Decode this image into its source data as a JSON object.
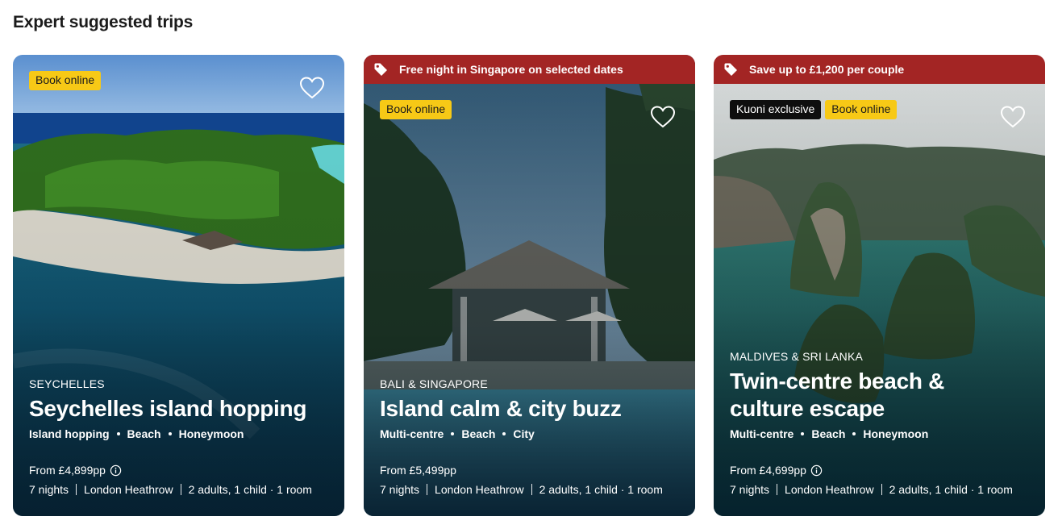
{
  "section": {
    "title": "Expert suggested trips"
  },
  "cards": [
    {
      "promo": "",
      "badges": {
        "primary": "Book online"
      },
      "region": "SEYCHELLES",
      "title_line1": "Seychelles island hopping",
      "title_line2": "",
      "tags": [
        "Island hopping",
        "Beach",
        "Honeymoon"
      ],
      "price": "From £4,899pp",
      "nights": "7 nights",
      "airport": "London Heathrow",
      "party": "2 adults, 1 child · 1 room"
    },
    {
      "promo": "Free night in Singapore on selected dates",
      "badges": {
        "primary": "Book online"
      },
      "region": "BALI & SINGAPORE",
      "title_line1": "Island calm & city buzz",
      "title_line2": "",
      "tags": [
        "Multi-centre",
        "Beach",
        "City"
      ],
      "price": "From £5,499pp",
      "nights": "7 nights",
      "airport": "London Heathrow",
      "party": "2 adults, 1 child · 1 room"
    },
    {
      "promo": "Save up to £1,200 per couple",
      "badges": {
        "exclusive": "Kuoni exclusive",
        "primary": "Book online"
      },
      "region": "MALDIVES & SRI LANKA",
      "title_line1": "Twin-centre beach &",
      "title_line2": "culture escape",
      "tags": [
        "Multi-centre",
        "Beach",
        "Honeymoon"
      ],
      "price": "From £4,699pp",
      "nights": "7 nights",
      "airport": "London Heathrow",
      "party": "2 adults, 1 child · 1 room"
    }
  ],
  "icons": {
    "promo": "tag-icon",
    "favourite": "heart-icon",
    "price_info": "info-icon"
  },
  "colors": {
    "promo_bar": "#a32524",
    "badge_yellow": "#f7c916",
    "badge_black": "#0e0e0e"
  }
}
